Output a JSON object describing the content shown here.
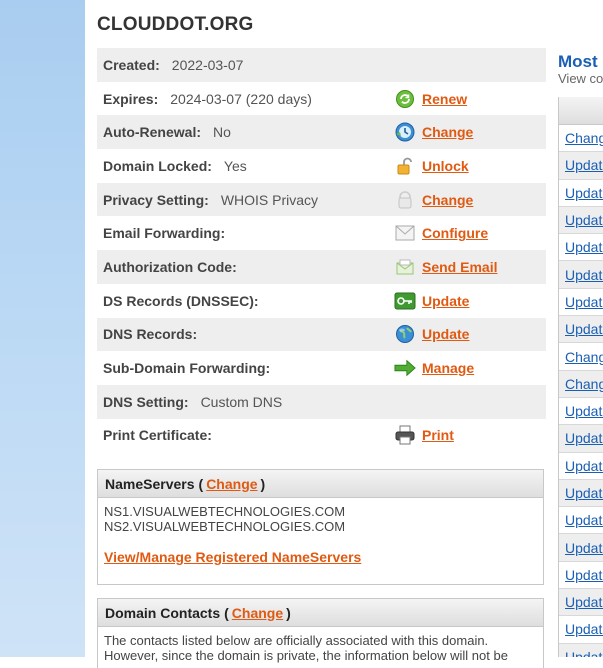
{
  "domain": {
    "title": "CLOUDDOT.ORG"
  },
  "info_rows": [
    {
      "label": "Created:",
      "value": "2022-03-07",
      "action": "",
      "icon": ""
    },
    {
      "label": "Expires:",
      "value": "2024-03-07 (220 days)",
      "action": "Renew",
      "icon": "renew-icon"
    },
    {
      "label": "Auto-Renewal:",
      "value": "No",
      "action": "Change",
      "icon": "clock-icon"
    },
    {
      "label": "Domain Locked:",
      "value": "Yes",
      "action": "Unlock",
      "icon": "lock-icon"
    },
    {
      "label": "Privacy Setting:",
      "value": "WHOIS Privacy",
      "action": "Change",
      "icon": "privacy-icon"
    },
    {
      "label": "Email Forwarding:",
      "value": "",
      "action": "Configure",
      "icon": "envelope-icon"
    },
    {
      "label": "Authorization Code:",
      "value": "",
      "action": "Send Email",
      "icon": "send-email-icon"
    },
    {
      "label": "DS Records (DNSSEC):",
      "value": "",
      "action": "Update",
      "icon": "key-icon"
    },
    {
      "label": "DNS Records:",
      "value": "",
      "action": "Update",
      "icon": "globe-icon"
    },
    {
      "label": "Sub-Domain Forwarding:",
      "value": "",
      "action": "Manage",
      "icon": "arrow-right-icon"
    },
    {
      "label": "DNS Setting:",
      "value": "Custom DNS",
      "action": "",
      "icon": ""
    },
    {
      "label": "Print Certificate:",
      "value": "",
      "action": "Print",
      "icon": "printer-icon"
    }
  ],
  "nameservers": {
    "heading": "NameServers",
    "change_label": "Change",
    "open_paren": "(",
    "close_paren": ")",
    "servers": [
      "NS1.VISUALWEBTECHNOLOGIES.COM",
      "NS2.VISUALWEBTECHNOLOGIES.COM"
    ],
    "manage_link": "View/Manage Registered NameServers"
  },
  "contacts": {
    "heading": "Domain Contacts",
    "change_label": "Change",
    "open_paren": "(",
    "close_paren": ")",
    "text": "The contacts listed below are officially associated with this domain. However, since the domain is private, the information below will not be"
  },
  "right_panel": {
    "title": "Most",
    "subtitle": "View co",
    "rows": [
      "Chang",
      "Update",
      "Update",
      "Update",
      "Update",
      "Update",
      "Update",
      "Update",
      "Chang",
      "Chang",
      "Update",
      "Update",
      "Update",
      "Update",
      "Update",
      "Update",
      "Update",
      "Update",
      "Update",
      "Update"
    ]
  },
  "colors": {
    "link": "#e05a12",
    "accent_blue": "#1a5fb4",
    "row_shade": "#eeeeee"
  }
}
